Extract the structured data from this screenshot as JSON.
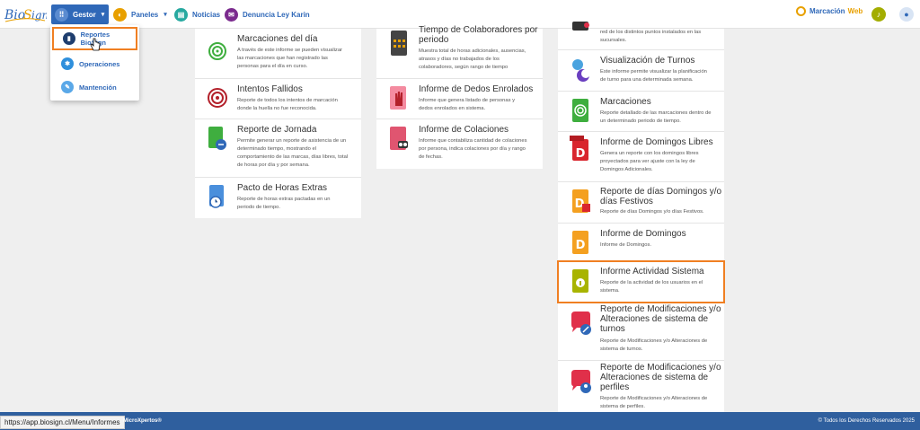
{
  "nav": {
    "logo": "BioSign",
    "gestor": "Gestor",
    "paneles": "Paneles",
    "noticias": "Noticias",
    "denuncia": "Denuncia Ley Karin",
    "marcacion": "Marcación",
    "marcacion_web": "Web"
  },
  "dropdown": {
    "items": [
      {
        "label": "Reportes BioSign"
      },
      {
        "label": "Operaciones"
      },
      {
        "label": "Mantención"
      }
    ]
  },
  "col1": [
    {
      "title": "Marcaciones del día",
      "desc": [
        "A través de este informe se pueden visualizar",
        "las marcaciones que han registrado las",
        "personas para el día en curso."
      ]
    },
    {
      "title": "Intentos Fallidos",
      "desc": [
        "Reporte de todos los intentos de marcación",
        "donde la huella no fue reconocida."
      ]
    },
    {
      "title": "Reporte de Jornada",
      "desc": [
        "Permite generar un reporte de asistencia de un",
        "determinado tiempo, mostrando el",
        "comportamiento de las marcas, días libres, total",
        "de horas por día y por semana."
      ]
    },
    {
      "title": "Pacto de Horas Extras",
      "desc": [
        "Reporte de horas extras pactadas en un",
        "periodo de tiempo."
      ]
    }
  ],
  "col2": [
    {
      "title1": "Tiempo de Colaboradores por",
      "title2": "periodo",
      "desc": [
        "Muestra total de horas adicionales, ausencias,",
        "atrasos y días no trabajados de los",
        "colaboradores, según rango de tiempo"
      ]
    },
    {
      "title": "Informe de Dedos Enrolados",
      "desc": [
        "Informe que genera listado de personas y",
        "dedos enrolados en sistema."
      ]
    },
    {
      "title": "Informe de Colaciones",
      "desc": [
        "Informe que contabiliza cantidad de colaciones",
        "por persona, indica colaciones por día y rango",
        "de fechas."
      ]
    }
  ],
  "col3": [
    {
      "desc": [
        "red de los distintos puntos instalados en las",
        "sucursales."
      ]
    },
    {
      "title": "Visualización de Turnos",
      "desc": [
        "Este informe permite visualizar la planificación",
        "de turno para una determinada semana."
      ]
    },
    {
      "title": "Marcaciones",
      "desc": [
        "Reporte detallado de las marcaciones dentro de",
        "un determinado periodo de tiempo."
      ]
    },
    {
      "title": "Informe de Domingos Libres",
      "desc": [
        "Genera un reporte con los domingos libres",
        "proyectados para ver ajuste con la ley de",
        "Domingos Adicionales."
      ]
    },
    {
      "title1": "Reporte de días Domingos y/o",
      "title2": "días Festivos",
      "desc": [
        "Reporte de días Domingos y/o días Festivos."
      ]
    },
    {
      "title": "Informe de Domingos",
      "desc": [
        "Informe de Domingos."
      ]
    },
    {
      "title": "Informe Actividad Sistema",
      "desc": [
        "Reporte de la actividad de los usuarios en el",
        "sistema."
      ]
    },
    {
      "title1": "Reporte de Modificaciones y/o",
      "title2": "Alteraciones de sistema de",
      "title3": "turnos",
      "desc": [
        "Reporte de Modificaciones y/o Alteraciones de",
        "sistema de turnos."
      ]
    },
    {
      "title1": "Reporte de Modificaciones y/o",
      "title2": "Alteraciones de sistema de",
      "title3": "perfiles",
      "desc": [
        "Reporte de Modificaciones y/o Alteraciones de",
        "sistema de perfiles."
      ]
    }
  ],
  "footer": {
    "url": "https://app.biosign.cl/Menu/Informes",
    "brand": "MicroXpertos®",
    "rights": "© Todos los Derechos Reservados 2025"
  },
  "colors": {
    "primary": "#2f68b8",
    "highlight": "#f07f22",
    "footer": "#2f5f9e"
  }
}
